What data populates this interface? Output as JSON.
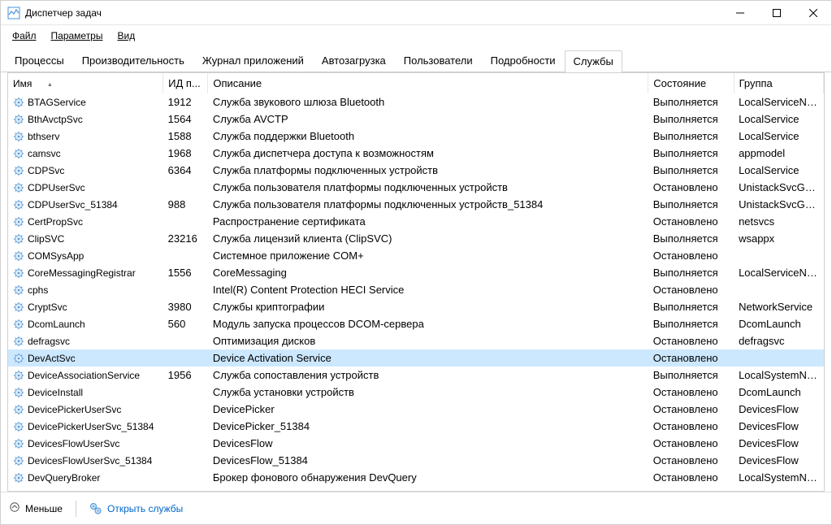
{
  "window": {
    "title": "Диспетчер задач"
  },
  "menu": {
    "file": "Файл",
    "options": "Параметры",
    "view": "Вид"
  },
  "tabs": {
    "processes": "Процессы",
    "performance": "Производительность",
    "app_history": "Журнал приложений",
    "startup": "Автозагрузка",
    "users": "Пользователи",
    "details": "Подробности",
    "services": "Службы"
  },
  "columns": {
    "name": "Имя",
    "pid": "ИД п...",
    "description": "Описание",
    "state": "Состояние",
    "group": "Группа"
  },
  "state_labels": {
    "running": "Выполняется",
    "stopped": "Остановлено"
  },
  "services": [
    {
      "name": "BTAGService",
      "pid": "1912",
      "desc": "Служба звукового шлюза Bluetooth",
      "state": "Выполняется",
      "group": "LocalServiceNe..."
    },
    {
      "name": "BthAvctpSvc",
      "pid": "1564",
      "desc": "Служба AVCTP",
      "state": "Выполняется",
      "group": "LocalService"
    },
    {
      "name": "bthserv",
      "pid": "1588",
      "desc": "Служба поддержки Bluetooth",
      "state": "Выполняется",
      "group": "LocalService"
    },
    {
      "name": "camsvc",
      "pid": "1968",
      "desc": "Служба диспетчера доступа к возможностям",
      "state": "Выполняется",
      "group": "appmodel"
    },
    {
      "name": "CDPSvc",
      "pid": "6364",
      "desc": "Служба платформы подключенных устройств",
      "state": "Выполняется",
      "group": "LocalService"
    },
    {
      "name": "CDPUserSvc",
      "pid": "",
      "desc": "Служба пользователя платформы подключенных устройств",
      "state": "Остановлено",
      "group": "UnistackSvcGro..."
    },
    {
      "name": "CDPUserSvc_51384",
      "pid": "988",
      "desc": "Служба пользователя платформы подключенных устройств_51384",
      "state": "Выполняется",
      "group": "UnistackSvcGro..."
    },
    {
      "name": "CertPropSvc",
      "pid": "",
      "desc": "Распространение сертификата",
      "state": "Остановлено",
      "group": "netsvcs"
    },
    {
      "name": "ClipSVC",
      "pid": "23216",
      "desc": "Служба лицензий клиента (ClipSVC)",
      "state": "Выполняется",
      "group": "wsappx"
    },
    {
      "name": "COMSysApp",
      "pid": "",
      "desc": "Системное приложение COM+",
      "state": "Остановлено",
      "group": ""
    },
    {
      "name": "CoreMessagingRegistrar",
      "pid": "1556",
      "desc": "CoreMessaging",
      "state": "Выполняется",
      "group": "LocalServiceNo..."
    },
    {
      "name": "cphs",
      "pid": "",
      "desc": "Intel(R) Content Protection HECI Service",
      "state": "Остановлено",
      "group": ""
    },
    {
      "name": "CryptSvc",
      "pid": "3980",
      "desc": "Службы криптографии",
      "state": "Выполняется",
      "group": "NetworkService"
    },
    {
      "name": "DcomLaunch",
      "pid": "560",
      "desc": "Модуль запуска процессов DCOM-сервера",
      "state": "Выполняется",
      "group": "DcomLaunch"
    },
    {
      "name": "defragsvc",
      "pid": "",
      "desc": "Оптимизация дисков",
      "state": "Остановлено",
      "group": "defragsvc"
    },
    {
      "name": "DevActSvc",
      "pid": "",
      "desc": "Device Activation Service",
      "state": "Остановлено",
      "group": "",
      "selected": true
    },
    {
      "name": "DeviceAssociationService",
      "pid": "1956",
      "desc": "Служба сопоставления устройств",
      "state": "Выполняется",
      "group": "LocalSystemNe..."
    },
    {
      "name": "DeviceInstall",
      "pid": "",
      "desc": "Служба установки устройств",
      "state": "Остановлено",
      "group": "DcomLaunch"
    },
    {
      "name": "DevicePickerUserSvc",
      "pid": "",
      "desc": "DevicePicker",
      "state": "Остановлено",
      "group": "DevicesFlow"
    },
    {
      "name": "DevicePickerUserSvc_51384",
      "pid": "",
      "desc": "DevicePicker_51384",
      "state": "Остановлено",
      "group": "DevicesFlow"
    },
    {
      "name": "DevicesFlowUserSvc",
      "pid": "",
      "desc": "DevicesFlow",
      "state": "Остановлено",
      "group": "DevicesFlow"
    },
    {
      "name": "DevicesFlowUserSvc_51384",
      "pid": "",
      "desc": "DevicesFlow_51384",
      "state": "Остановлено",
      "group": "DevicesFlow"
    },
    {
      "name": "DevQueryBroker",
      "pid": "",
      "desc": "Брокер фонового обнаружения DevQuery",
      "state": "Остановлено",
      "group": "LocalSystemNe..."
    }
  ],
  "footer": {
    "fewer": "Меньше",
    "open_services": "Открыть службы"
  }
}
